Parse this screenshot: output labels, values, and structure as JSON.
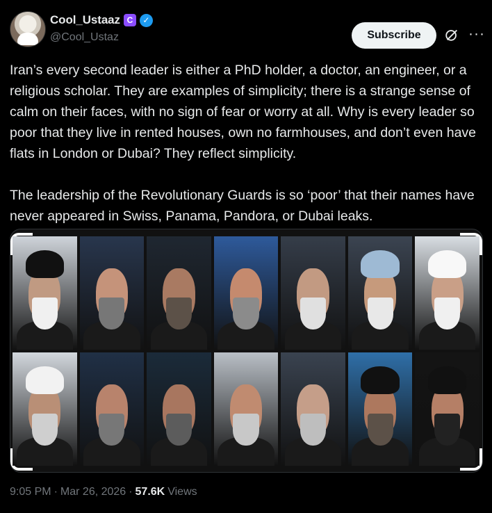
{
  "author": {
    "display_name": "Cool_Ustaaz",
    "handle": "@Cool_Ustaz",
    "affiliate_badge_letter": "C",
    "verified_icon": "verified-check-icon"
  },
  "actions": {
    "subscribe_label": "Subscribe",
    "grok_icon": "grok-slash-circle-icon",
    "more_icon": "more-dots-icon",
    "more_text": "···"
  },
  "tweet": {
    "text": "Iran’s every second leader is either a PhD holder, a doctor, an engineer, or a religious scholar. They are examples of simplicity; there is a strange sense of calm on their faces, with no sign of fear or worry at all. Why is every leader so poor that they live in rented houses, own no farmhouses, and don’t even have flats in London or Dubai? They reflect simplicity.\n\nThe leadership of the Revolutionary Guards is so ‘poor’ that their names have never appeared in Swiss, Panama, Pandora, or Dubai leaks."
  },
  "media": {
    "description_icon": "portrait-collage-image",
    "portraits": [
      {
        "turban": "#111111",
        "beard": "#f0f0f0",
        "bg": "#cfd4da",
        "face": "#c09a82"
      },
      {
        "turban": "none",
        "beard": "#777777",
        "bg": "#28364d",
        "face": "#c5937a"
      },
      {
        "turban": "none",
        "beard": "#5c5148",
        "bg": "#1f2731",
        "face": "#a97a62"
      },
      {
        "turban": "none",
        "beard": "#8b8b8b",
        "bg": "#2e5a9b",
        "face": "#c58a6e"
      },
      {
        "turban": "none",
        "beard": "#e0e0e0",
        "bg": "#353d49",
        "face": "#c29a82"
      },
      {
        "turban": "#9ebad4",
        "beard": "#e8e8e8",
        "bg": "#3b4451",
        "face": "#c69a7c"
      },
      {
        "turban": "#f8f8f8",
        "beard": "#f0f0f0",
        "bg": "#d8dde2",
        "face": "#c99f87"
      },
      {
        "turban": "#f2f2f2",
        "beard": "#cfcfcf",
        "bg": "#d2d7dd",
        "face": "#b98f76"
      },
      {
        "turban": "none",
        "beard": "#777777",
        "bg": "#203046",
        "face": "#b8836c"
      },
      {
        "turban": "none",
        "beard": "#5c5c5c",
        "bg": "#1b2b3a",
        "face": "#a8765f"
      },
      {
        "turban": "none",
        "beard": "#c8c8c8",
        "bg": "#b9bfc6",
        "face": "#c08b70"
      },
      {
        "turban": "none",
        "beard": "#bebebe",
        "bg": "#3a4350",
        "face": "#c59e89"
      },
      {
        "turban": "#111111",
        "beard": "#5c5148",
        "bg": "#2f6fa8",
        "face": "#ad785e"
      },
      {
        "turban": "#111111",
        "beard": "#222222",
        "bg": "#141414",
        "face": "#b57f66"
      }
    ]
  },
  "meta": {
    "time": "9:05 PM",
    "separator": "·",
    "date": "Mar 26, 2026",
    "views_count": "57.6K",
    "views_label": "Views"
  }
}
